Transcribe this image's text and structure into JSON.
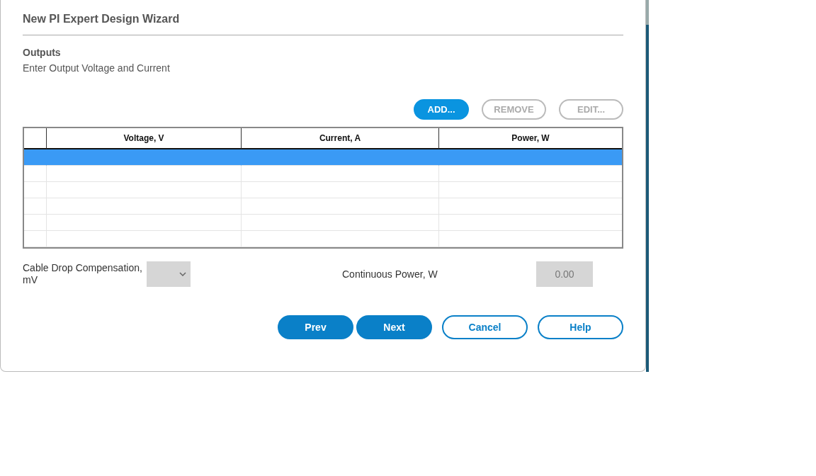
{
  "dialog": {
    "title": "New PI Expert Design Wizard"
  },
  "section": {
    "heading": "Outputs",
    "subtitle": "Enter Output Voltage and Current"
  },
  "toolbar": [
    {
      "label": "ADD...",
      "disabled": false
    },
    {
      "label": "REMOVE",
      "disabled": true
    },
    {
      "label": "EDIT...",
      "disabled": true
    }
  ],
  "table": {
    "columns": [
      "Voltage, V",
      "Current, A",
      "Power, W"
    ],
    "rows": [
      {
        "selected": true
      },
      {
        "selected": false
      },
      {
        "selected": false
      },
      {
        "selected": false
      },
      {
        "selected": false
      },
      {
        "selected": false
      }
    ]
  },
  "cable_drop": {
    "label": "Cable Drop Compensation, mV"
  },
  "continuous_power": {
    "label": "Continuous Power, W",
    "value": "0.00"
  },
  "buttons": [
    {
      "label": "Prev",
      "kind": "primary"
    },
    {
      "label": "Next",
      "kind": "primary"
    },
    {
      "label": "Cancel",
      "kind": "secondary"
    },
    {
      "label": "Help",
      "kind": "secondary"
    }
  ]
}
